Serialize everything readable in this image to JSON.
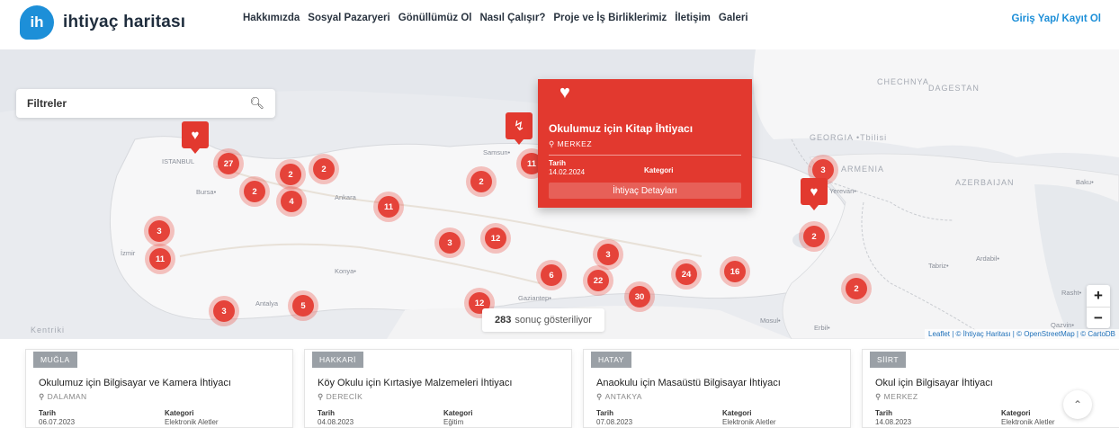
{
  "header": {
    "logo_badge": "ih",
    "logo_text": "ihtiyaç haritası",
    "nav": [
      "Hakkımızda",
      "Sosyal Pazaryeri",
      "Gönüllümüz Ol",
      "Nasıl Çalışır?",
      "Proje ve İş Birliklerimiz",
      "İletişim",
      "Galeri"
    ],
    "login": "Giriş Yap/ Kayıt Ol"
  },
  "map": {
    "filter_label": "Filtreler",
    "search_icon": "search-icon",
    "clusters": [
      "27",
      "2",
      "2",
      "2",
      "4",
      "11",
      "2",
      "3",
      "12",
      "3",
      "11",
      "3",
      "6",
      "22",
      "30",
      "24",
      "16",
      "12",
      "5",
      "3",
      "2",
      "2",
      "3",
      "11"
    ],
    "labels": {
      "istanbul": "ISTANBUL",
      "bursa": "Bursa•",
      "ankara": "Ankara",
      "konya": "Konya•",
      "antalya": "Antalya",
      "izmir": "İzmir",
      "samsun": "Samsun•",
      "gaziantep": "Gaziantep•",
      "mosul": "Mosul•",
      "erbil": "Erbil•",
      "tabriz": "Tabriz•",
      "ardabil": "Ardabil•",
      "rasht": "Rasht•",
      "qazvin": "Qazvin•",
      "baku": "Baku•",
      "georgia": "GEORGIA •Tbilisi",
      "armenia": "ARMENIA",
      "azerbaijan": "AZERBAIJAN",
      "chechnya": "CHECHNYA",
      "dagestan": "DAGESTAN",
      "yerevan": "Yerevan•",
      "kentriki": "Kentriki"
    },
    "popup": {
      "icon": "heart-icon",
      "title": "Okulumuz için Kitap İhtiyacı",
      "location": "MERKEZ",
      "date_label": "Tarih",
      "date_value": "14.02.2024",
      "category_label": "Kategori",
      "button": "İhtiyaç Detayları"
    },
    "results": {
      "count": "283",
      "text": "sonuç gösteriliyor"
    },
    "zoom": {
      "in": "+",
      "out": "−"
    },
    "attribution": "Leaflet | © İhtiyaç Haritası | © OpenStreetMap | © CartoDB"
  },
  "cards": [
    {
      "tag": "MUĞLA",
      "title": "Okulumuz için Bilgisayar ve Kamera İhtiyacı",
      "location": "DALAMAN",
      "date_label": "Tarih",
      "date": "06.07.2023",
      "category_label": "Kategori",
      "category": "Elektronik Aletler"
    },
    {
      "tag": "HAKKARİ",
      "title": "Köy Okulu için Kırtasiye Malzemeleri İhtiyacı",
      "location": "DERECİK",
      "date_label": "Tarih",
      "date": "04.08.2023",
      "category_label": "Kategori",
      "category": "Eğitim"
    },
    {
      "tag": "HATAY",
      "title": "Anaokulu için Masaüstü Bilgisayar İhtiyacı",
      "location": "ANTAKYA",
      "date_label": "Tarih",
      "date": "07.08.2023",
      "category_label": "Kategori",
      "category": "Elektronik Aletler"
    },
    {
      "tag": "SİİRT",
      "title": "Okul için Bilgisayar İhtiyacı",
      "location": "MERKEZ",
      "date_label": "Tarih",
      "date": "14.08.2023",
      "category_label": "Kategori",
      "category": "Elektronik Aletler"
    }
  ],
  "scroll_top_icon": "chevron-up-icon",
  "colors": {
    "accent": "#e2392f",
    "brand": "#1d8fd8",
    "tag": "#9aa0a6"
  }
}
